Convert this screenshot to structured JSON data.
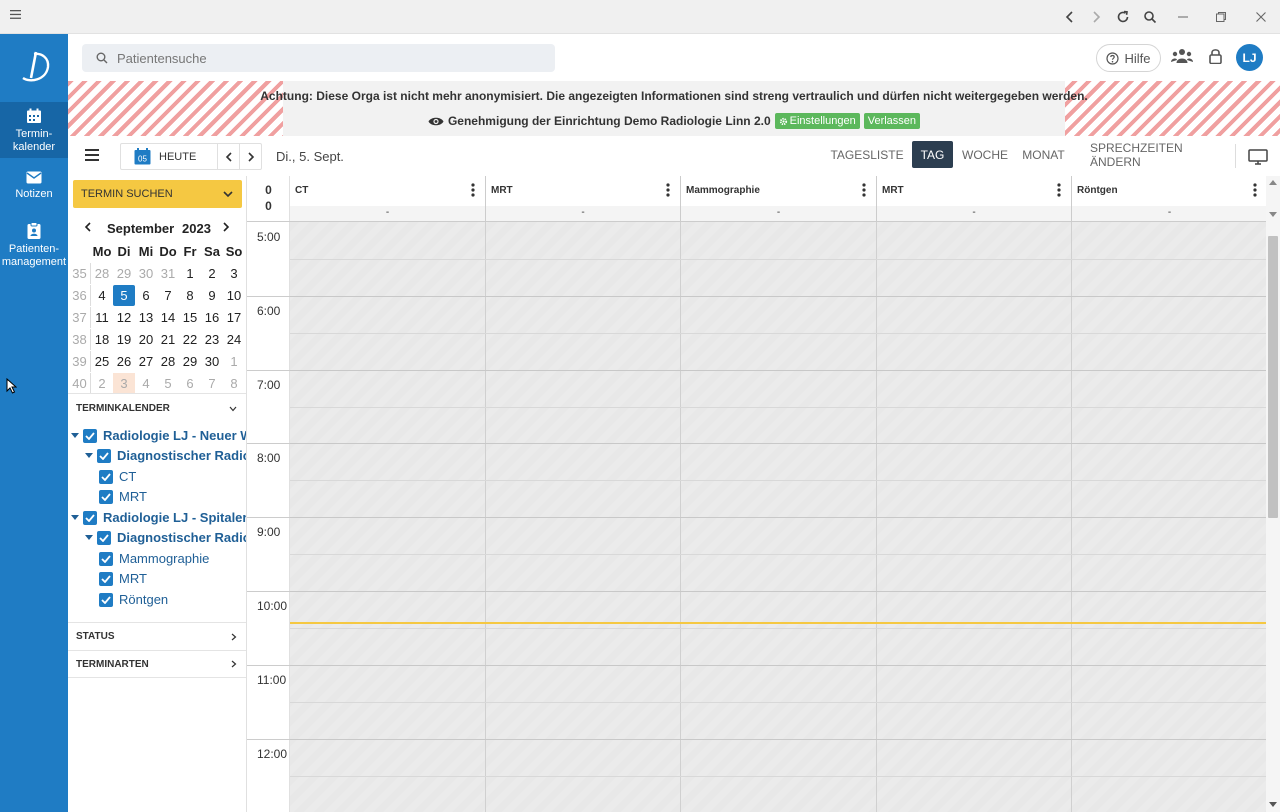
{
  "window": {
    "menu_icon": "hamburger-icon",
    "controls": [
      "back-icon",
      "forward-icon",
      "reload-icon",
      "zoom-icon",
      "minimize-icon",
      "restore-icon",
      "close-icon"
    ]
  },
  "sidebar": {
    "items": [
      {
        "label1": "Termin-",
        "label2": "kalender",
        "icon": "calendar-icon",
        "active": true
      },
      {
        "label1": "Notizen",
        "label2": "",
        "icon": "mail-icon",
        "active": false
      },
      {
        "label1": "Patienten-",
        "label2": "management",
        "icon": "clipboard-icon",
        "active": false
      }
    ]
  },
  "topbar": {
    "search_placeholder": "Patientensuche",
    "help_label": "Hilfe",
    "avatar_initials": "LJ"
  },
  "banner": {
    "warning": "Achtung: Diese Orga ist nicht mehr anonymisiert. Die angezeigten Informationen sind streng vertraulich und dürfen nicht weitergegeben werden.",
    "approval": "Genehmigung der Einrichtung Demo Radiologie Linn 2.0",
    "settings_label": "Einstellungen",
    "leave_label": "Verlassen"
  },
  "toolbar": {
    "calendar_badge": "05",
    "today_label": "HEUTE",
    "date_label": "Di., 5. Sept.",
    "views": [
      "TAGESLISTE",
      "TAG",
      "WOCHE",
      "MONAT"
    ],
    "active_view": "TAG",
    "hours_label": "SPRECHZEITEN ÄNDERN"
  },
  "left": {
    "search_appt_label": "TERMIN SUCHEN",
    "minical": {
      "month": "September",
      "year": "2023",
      "daynames": [
        "Mo",
        "Di",
        "Mi",
        "Do",
        "Fr",
        "Sa",
        "So"
      ],
      "weeks": [
        {
          "wk": "35",
          "days": [
            "28",
            "29",
            "30",
            "31",
            "1",
            "2",
            "3"
          ]
        },
        {
          "wk": "36",
          "days": [
            "4",
            "5",
            "6",
            "7",
            "8",
            "9",
            "10"
          ]
        },
        {
          "wk": "37",
          "days": [
            "11",
            "12",
            "13",
            "14",
            "15",
            "16",
            "17"
          ]
        },
        {
          "wk": "38",
          "days": [
            "18",
            "19",
            "20",
            "21",
            "22",
            "23",
            "24"
          ]
        },
        {
          "wk": "39",
          "days": [
            "25",
            "26",
            "27",
            "28",
            "29",
            "30",
            "1"
          ]
        },
        {
          "wk": "40",
          "days": [
            "2",
            "3",
            "4",
            "5",
            "6",
            "7",
            "8"
          ]
        }
      ],
      "selected": "5"
    },
    "section_calendar": "TERMINKALENDER",
    "tree": [
      "Radiologie LJ - Neuer Wall",
      "Diagnostischer Radiologie",
      "CT",
      "MRT",
      "Radiologie LJ - Spitalerstraße",
      "Diagnostischer Radiologie",
      "Mammographie",
      "MRT",
      "Röntgen"
    ],
    "section_status": "STATUS",
    "section_types": "TERMINARTEN"
  },
  "grid": {
    "header_counts": [
      "0",
      "0"
    ],
    "columns": [
      {
        "name": "CT",
        "sub": "-"
      },
      {
        "name": "MRT",
        "sub": "-"
      },
      {
        "name": "Mammographie",
        "sub": "-"
      },
      {
        "name": "MRT",
        "sub": "-"
      },
      {
        "name": "Röntgen",
        "sub": "-"
      }
    ],
    "hours": [
      "5:00",
      "6:00",
      "7:00",
      "8:00",
      "9:00",
      "10:00",
      "11:00",
      "12:00"
    ],
    "now_time": "10:25"
  },
  "colors": {
    "brand": "#1f7cc4",
    "accent": "#f5c842",
    "active_view": "#2c3e50",
    "green": "#5cb85c"
  }
}
